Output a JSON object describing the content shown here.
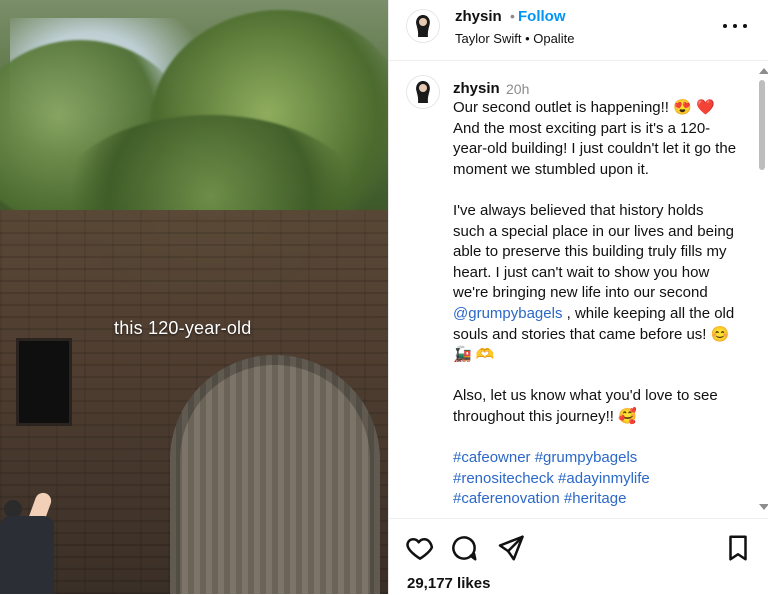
{
  "media": {
    "caption": "this 120-year-old"
  },
  "header": {
    "username": "zhysin",
    "separator": "•",
    "follow_label": "Follow",
    "music": "Taylor Swift • Opalite"
  },
  "post": {
    "username": "zhysin",
    "time": "20h",
    "para1": "Our second outlet is happening!! 😍 ❤️ And the most exciting part is it's a 120-year-old building! I just couldn't let it go the moment we stumbled upon it.",
    "para2_before": "I've always believed that history holds such a special place in our lives and being able to preserve this building truly fills my heart. I just can't wait to show you how we're bringing new life into our second ",
    "mention": "@grumpybagels",
    "para2_after": " , while keeping all the old souls and stories that came before us! 😊 🚂 🫶",
    "para3": "Also, let us know what you'd love to see throughout this journey!! 🥰",
    "hashtags": "#cafeowner #grumpybagels #renositecheck #adayinmylife #caferenovation #heritage"
  },
  "actions": {
    "likes": "29,177 likes"
  },
  "icons": {
    "more": "more-options-icon",
    "like": "heart-icon",
    "comment": "comment-icon",
    "share": "share-icon",
    "save": "bookmark-icon"
  }
}
